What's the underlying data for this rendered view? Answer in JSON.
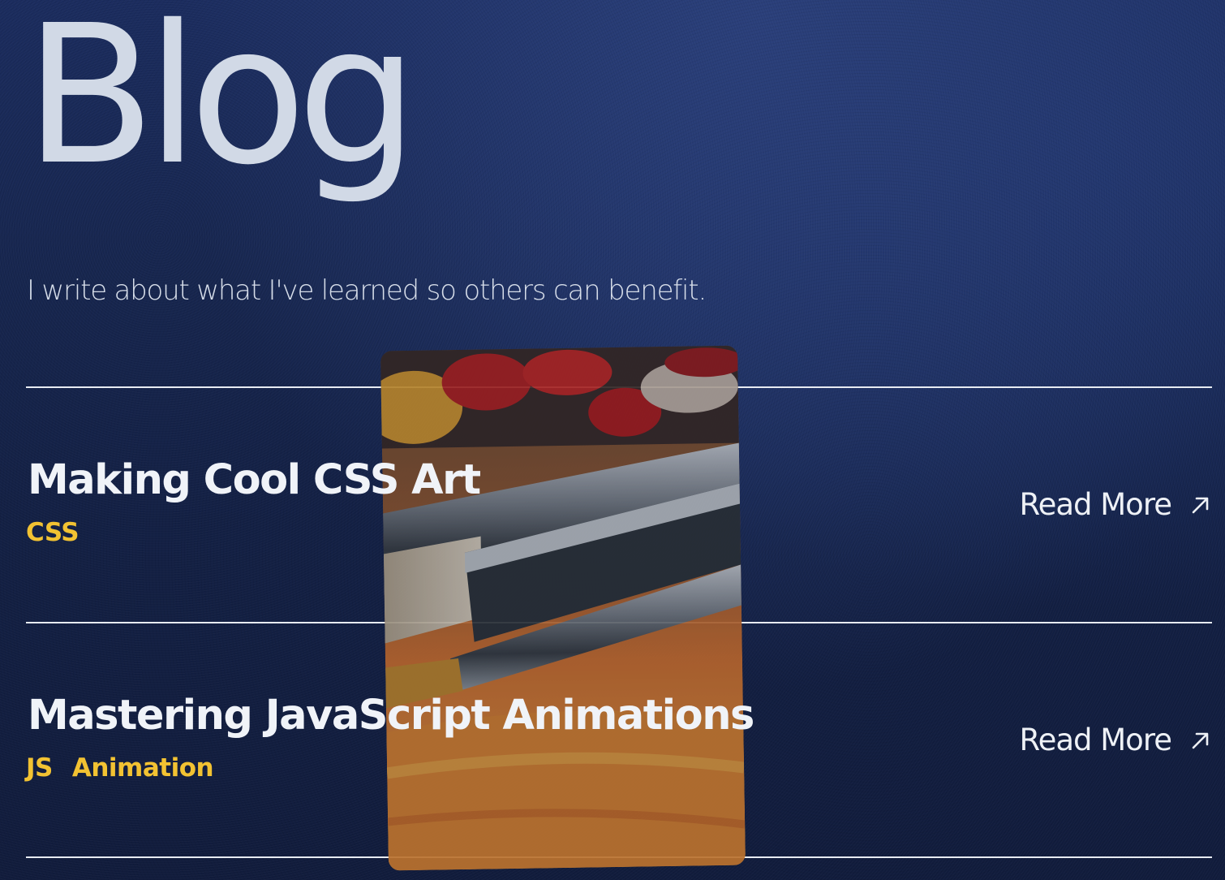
{
  "page": {
    "title": "Blog",
    "tagline": "I write about what I've learned so others can benefit."
  },
  "posts": [
    {
      "title": "Making Cool CSS Art",
      "tags": [
        "CSS"
      ],
      "read_more_label": "Read More",
      "icon": "arrow-up-right-icon"
    },
    {
      "title": "Mastering JavaScript Animations",
      "tags": [
        "JS",
        "Animation"
      ],
      "read_more_label": "Read More",
      "icon": "arrow-up-right-icon"
    }
  ],
  "colors": {
    "tag": "#f2c232",
    "text": "#f0f3f8",
    "background": "#17264f"
  },
  "preview_image": "paint-brushes-photo"
}
